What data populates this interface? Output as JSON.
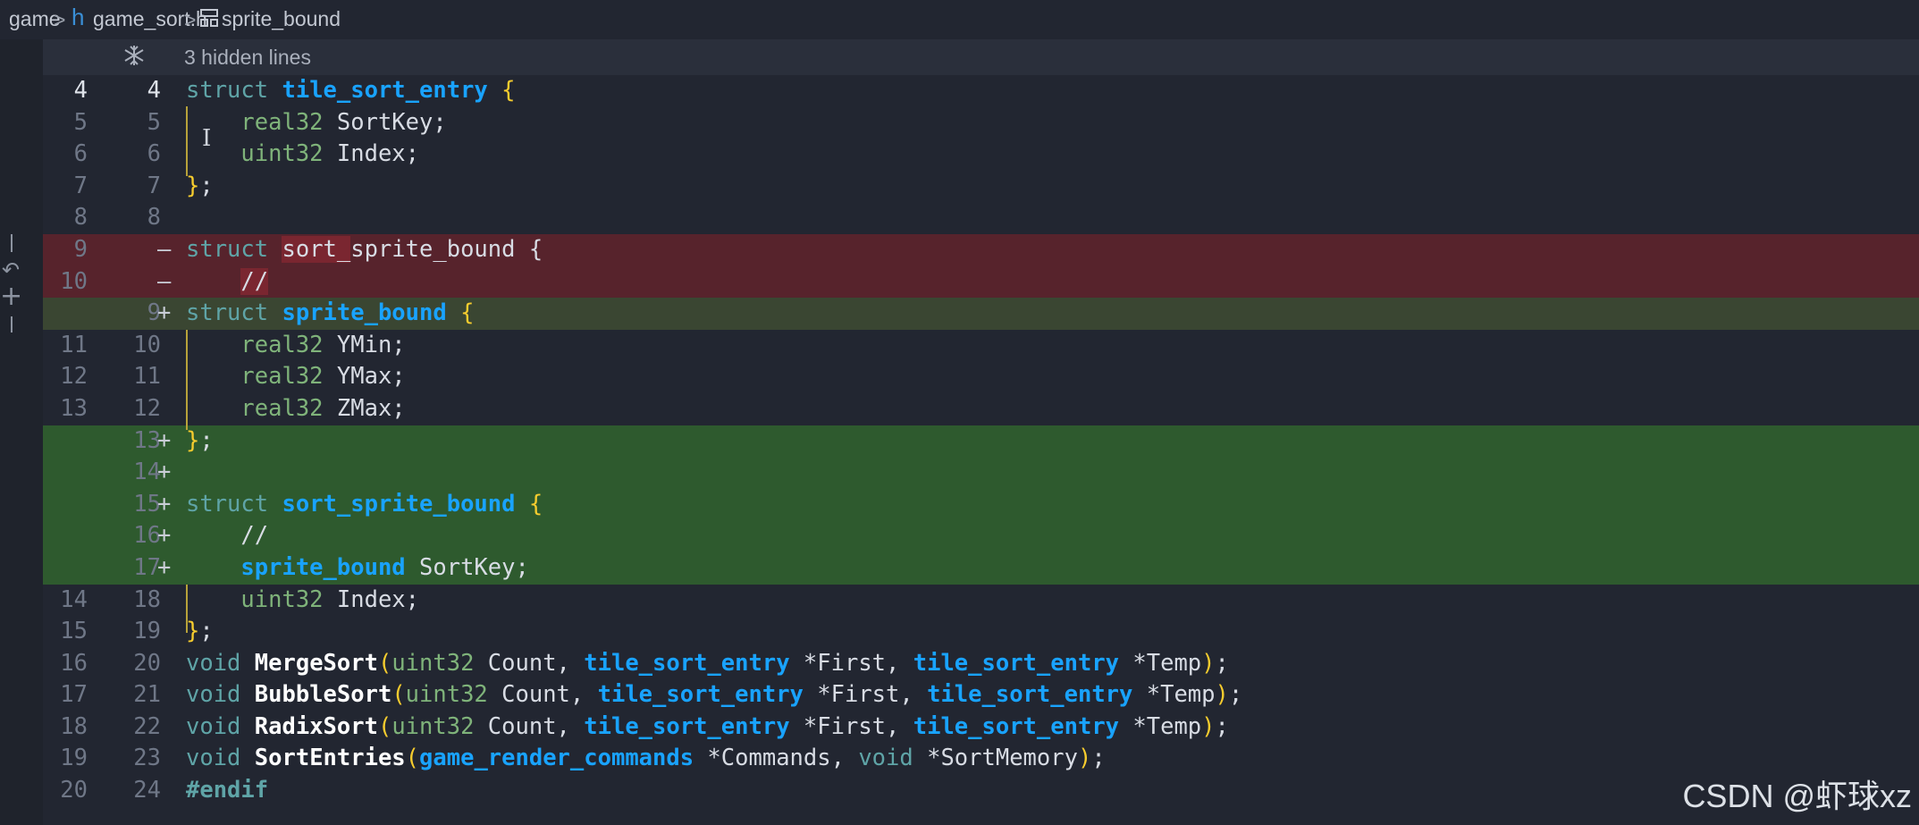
{
  "breadcrumb": {
    "items": [
      "game",
      "game_sort.h",
      "sprite_bound"
    ],
    "file_icon": "h",
    "separator": ">"
  },
  "hidden_lines": {
    "label": "3 hidden lines",
    "icon": "fold-expand-icon"
  },
  "watermark": "CSDN @虾球xz",
  "colors": {
    "background": "#222631",
    "deleted_line": "#57232c",
    "added_line": "#2e5a2e",
    "modified_line": "#3a4632",
    "struct_name": "#19a3ff",
    "keyword": "#5fa4a7",
    "type": "#7fb37a",
    "brace": "#f6cc2e"
  },
  "lines": [
    {
      "left": "4",
      "right": "4",
      "marker": "",
      "kind": "normal",
      "current": true,
      "tokens": [
        [
          "kw",
          "struct"
        ],
        [
          "pr",
          " "
        ],
        [
          "st",
          "tile_sort_entry"
        ],
        [
          "pr",
          " "
        ],
        [
          "br",
          "{"
        ]
      ]
    },
    {
      "left": "5",
      "right": "5",
      "marker": "",
      "kind": "normal",
      "tokens": [
        [
          "pr",
          "    "
        ],
        [
          "ty",
          "real32"
        ],
        [
          "pr",
          " SortKey;"
        ]
      ]
    },
    {
      "left": "6",
      "right": "6",
      "marker": "",
      "kind": "normal",
      "tokens": [
        [
          "pr",
          "    "
        ],
        [
          "ty",
          "uint32"
        ],
        [
          "pr",
          " Index;"
        ]
      ]
    },
    {
      "left": "7",
      "right": "7",
      "marker": "",
      "kind": "normal",
      "tokens": [
        [
          "br",
          "}"
        ],
        [
          "pr",
          ";"
        ]
      ]
    },
    {
      "left": "8",
      "right": "8",
      "marker": "",
      "kind": "normal",
      "tokens": []
    },
    {
      "left": "9",
      "right": "",
      "marker": "—",
      "kind": "del",
      "tokens": [
        [
          "kw",
          "struct"
        ],
        [
          "pr",
          " "
        ],
        [
          "hl",
          "sort_"
        ],
        [
          "pr",
          "sprite_bound {"
        ]
      ]
    },
    {
      "left": "10",
      "right": "",
      "marker": "—",
      "kind": "del",
      "tokens": [
        [
          "pr",
          "    "
        ],
        [
          "hl",
          "//"
        ]
      ]
    },
    {
      "left": "",
      "right": "9",
      "marker": "+",
      "kind": "addmix",
      "tokens": [
        [
          "kw",
          "struct"
        ],
        [
          "pr",
          " "
        ],
        [
          "st",
          "sprite_bound"
        ],
        [
          "pr",
          " "
        ],
        [
          "br",
          "{"
        ]
      ]
    },
    {
      "left": "11",
      "right": "10",
      "marker": "",
      "kind": "normal",
      "tokens": [
        [
          "pr",
          "    "
        ],
        [
          "ty",
          "real32"
        ],
        [
          "pr",
          " YMin;"
        ]
      ]
    },
    {
      "left": "12",
      "right": "11",
      "marker": "",
      "kind": "normal",
      "tokens": [
        [
          "pr",
          "    "
        ],
        [
          "ty",
          "real32"
        ],
        [
          "pr",
          " YMax;"
        ]
      ]
    },
    {
      "left": "13",
      "right": "12",
      "marker": "",
      "kind": "normal",
      "tokens": [
        [
          "pr",
          "    "
        ],
        [
          "ty",
          "real32"
        ],
        [
          "pr",
          " ZMax;"
        ]
      ]
    },
    {
      "left": "",
      "right": "13",
      "marker": "+",
      "kind": "add",
      "tokens": [
        [
          "br",
          "}"
        ],
        [
          "pr",
          ";"
        ]
      ]
    },
    {
      "left": "",
      "right": "14",
      "marker": "+",
      "kind": "add",
      "tokens": []
    },
    {
      "left": "",
      "right": "15",
      "marker": "+",
      "kind": "add",
      "tokens": [
        [
          "kw",
          "struct"
        ],
        [
          "pr",
          " "
        ],
        [
          "st",
          "sort_sprite_bound"
        ],
        [
          "pr",
          " "
        ],
        [
          "br",
          "{"
        ]
      ]
    },
    {
      "left": "",
      "right": "16",
      "marker": "+",
      "kind": "add",
      "tokens": [
        [
          "pr",
          "    //"
        ]
      ]
    },
    {
      "left": "",
      "right": "17",
      "marker": "+",
      "kind": "add",
      "tokens": [
        [
          "pr",
          "    "
        ],
        [
          "st",
          "sprite_bound"
        ],
        [
          "pr",
          " SortKey;"
        ]
      ]
    },
    {
      "left": "14",
      "right": "18",
      "marker": "",
      "kind": "normal",
      "tokens": [
        [
          "pr",
          "    "
        ],
        [
          "ty",
          "uint32"
        ],
        [
          "pr",
          " Index;"
        ]
      ]
    },
    {
      "left": "15",
      "right": "19",
      "marker": "",
      "kind": "normal",
      "tokens": [
        [
          "br",
          "}"
        ],
        [
          "pr",
          ";"
        ]
      ]
    },
    {
      "left": "16",
      "right": "20",
      "marker": "",
      "kind": "normal",
      "tokens": [
        [
          "kw",
          "void"
        ],
        [
          "pr",
          " "
        ],
        [
          "fn",
          "MergeSort"
        ],
        [
          "br",
          "("
        ],
        [
          "ty",
          "uint32"
        ],
        [
          "pr",
          " Count, "
        ],
        [
          "st",
          "tile_sort_entry"
        ],
        [
          "pr",
          " *First, "
        ],
        [
          "st",
          "tile_sort_entry"
        ],
        [
          "pr",
          " *Temp"
        ],
        [
          "br",
          ")"
        ],
        [
          "pr",
          ";"
        ]
      ]
    },
    {
      "left": "17",
      "right": "21",
      "marker": "",
      "kind": "normal",
      "tokens": [
        [
          "kw",
          "void"
        ],
        [
          "pr",
          " "
        ],
        [
          "fn",
          "BubbleSort"
        ],
        [
          "br",
          "("
        ],
        [
          "ty",
          "uint32"
        ],
        [
          "pr",
          " Count, "
        ],
        [
          "st",
          "tile_sort_entry"
        ],
        [
          "pr",
          " *First, "
        ],
        [
          "st",
          "tile_sort_entry"
        ],
        [
          "pr",
          " *Temp"
        ],
        [
          "br",
          ")"
        ],
        [
          "pr",
          ";"
        ]
      ]
    },
    {
      "left": "18",
      "right": "22",
      "marker": "",
      "kind": "normal",
      "tokens": [
        [
          "kw",
          "void"
        ],
        [
          "pr",
          " "
        ],
        [
          "fn",
          "RadixSort"
        ],
        [
          "br",
          "("
        ],
        [
          "ty",
          "uint32"
        ],
        [
          "pr",
          " Count, "
        ],
        [
          "st",
          "tile_sort_entry"
        ],
        [
          "pr",
          " *First, "
        ],
        [
          "st",
          "tile_sort_entry"
        ],
        [
          "pr",
          " *Temp"
        ],
        [
          "br",
          ")"
        ],
        [
          "pr",
          ";"
        ]
      ]
    },
    {
      "left": "19",
      "right": "23",
      "marker": "",
      "kind": "normal",
      "tokens": [
        [
          "kw",
          "void"
        ],
        [
          "pr",
          " "
        ],
        [
          "fn",
          "SortEntries"
        ],
        [
          "br",
          "("
        ],
        [
          "st",
          "game_render_commands"
        ],
        [
          "pr",
          " *Commands, "
        ],
        [
          "kw",
          "void"
        ],
        [
          "pr",
          " *SortMemory"
        ],
        [
          "br",
          ")"
        ],
        [
          "pr",
          ";"
        ]
      ]
    },
    {
      "left": "20",
      "right": "24",
      "marker": "",
      "kind": "normal",
      "tokens": [
        [
          "kwb",
          "#endif"
        ]
      ]
    }
  ]
}
